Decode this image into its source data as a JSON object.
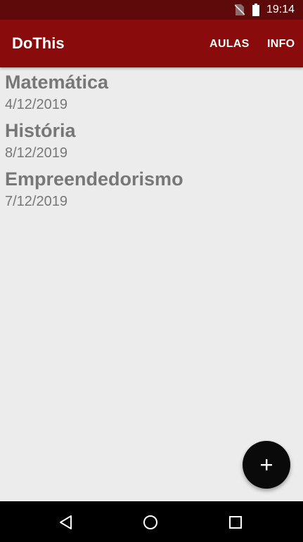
{
  "status_bar": {
    "time": "19:14",
    "icons": [
      "no-sim-icon",
      "battery-icon"
    ]
  },
  "app_bar": {
    "title": "DoThis",
    "actions": [
      {
        "label": "AULAS"
      },
      {
        "label": "INFO"
      }
    ]
  },
  "list": {
    "items": [
      {
        "title": "Matemática",
        "date": "4/12/2019"
      },
      {
        "title": "História",
        "date": "8/12/2019"
      },
      {
        "title": "Empreendedorismo",
        "date": "7/12/2019"
      }
    ]
  },
  "fab": {
    "icon": "plus-icon"
  },
  "nav_bar": {
    "icons": [
      "back-icon",
      "home-icon",
      "recents-icon"
    ]
  },
  "colors": {
    "status_bar": "#5e0a0a",
    "app_bar": "#8a0b0b",
    "background": "#ececec",
    "text": "#777777",
    "fab": "#0a0a0a"
  }
}
